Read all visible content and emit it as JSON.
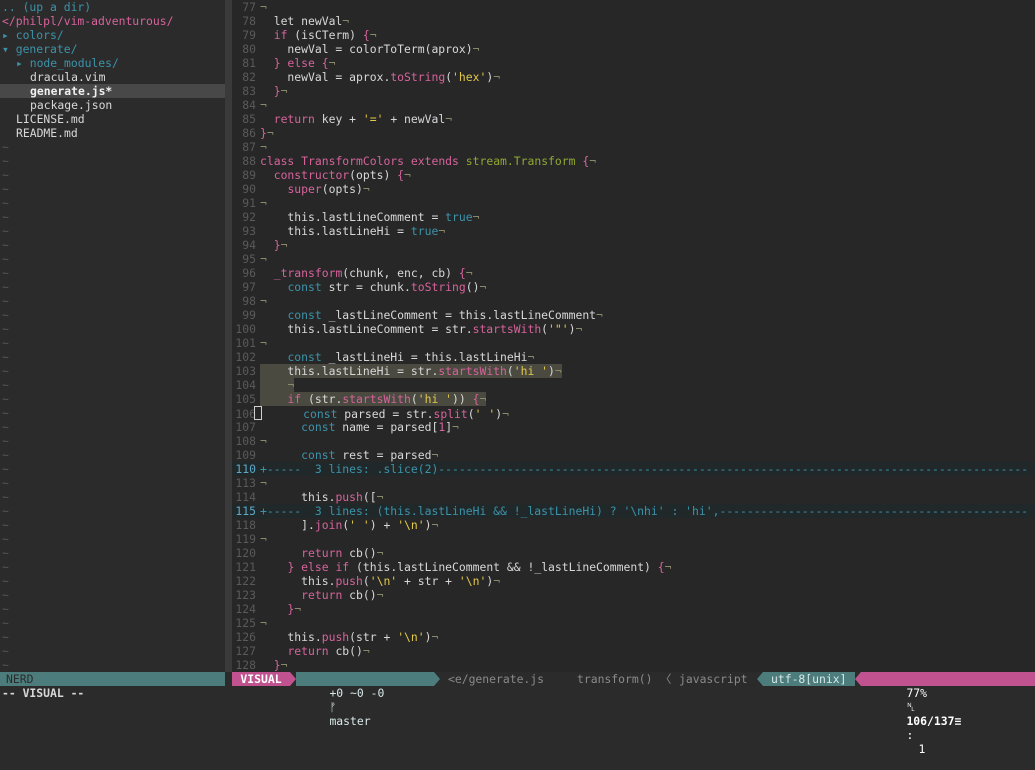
{
  "tree": {
    "up_dir": ".. (up a dir)",
    "root": "</philpl/vim-adventurous/",
    "items": [
      {
        "text": "▸ colors/",
        "kind": "dir",
        "indent": 0
      },
      {
        "text": "▾ generate/",
        "kind": "dir",
        "indent": 0
      },
      {
        "text": "▸ node_modules/",
        "kind": "dir",
        "indent": 1
      },
      {
        "text": "dracula.vim",
        "kind": "file",
        "indent": 2
      },
      {
        "text": "generate.js*",
        "kind": "exec",
        "indent": 2,
        "selected": true
      },
      {
        "text": "package.json",
        "kind": "file",
        "indent": 2
      },
      {
        "text": "LICENSE.md",
        "kind": "file",
        "indent": 1
      },
      {
        "text": "README.md",
        "kind": "file",
        "indent": 1
      }
    ],
    "tilde": "~",
    "tilde_count": 38
  },
  "editor": {
    "lines": [
      {
        "n": "77",
        "t": []
      },
      {
        "n": "78",
        "t": [
          [
            "  let newVal",
            "w"
          ]
        ]
      },
      {
        "n": "79",
        "t": [
          [
            "  ",
            "w"
          ],
          [
            "if",
            "p"
          ],
          [
            " (isCTerm) ",
            "w"
          ],
          [
            "{",
            "p"
          ]
        ]
      },
      {
        "n": "80",
        "t": [
          [
            "    newVal = colorToTerm(aprox)",
            "w"
          ]
        ]
      },
      {
        "n": "81",
        "t": [
          [
            "  ",
            "w"
          ],
          [
            "} else {",
            "p"
          ]
        ]
      },
      {
        "n": "82",
        "t": [
          [
            "    newVal = aprox.",
            "w"
          ],
          [
            "toString",
            "p"
          ],
          [
            "(",
            "w"
          ],
          [
            "'hex'",
            "y"
          ],
          [
            ")",
            "w"
          ]
        ]
      },
      {
        "n": "83",
        "t": [
          [
            "  }",
            "p"
          ]
        ]
      },
      {
        "n": "84",
        "t": []
      },
      {
        "n": "85",
        "t": [
          [
            "  ",
            "w"
          ],
          [
            "return",
            "p"
          ],
          [
            " key + ",
            "w"
          ],
          [
            "'='",
            "y"
          ],
          [
            " + newVal",
            "w"
          ]
        ]
      },
      {
        "n": "86",
        "t": [
          [
            "}",
            "p"
          ]
        ]
      },
      {
        "n": "87",
        "t": []
      },
      {
        "n": "88",
        "t": [
          [
            "class",
            "p"
          ],
          [
            " ",
            "w"
          ],
          [
            "TransformColors",
            "p"
          ],
          [
            " ",
            "w"
          ],
          [
            "extends",
            "p"
          ],
          [
            " ",
            "w"
          ],
          [
            "stream.Transform",
            "g"
          ],
          [
            " ",
            "w"
          ],
          [
            "{",
            "p"
          ]
        ]
      },
      {
        "n": "89",
        "t": [
          [
            "  ",
            "w"
          ],
          [
            "constructor",
            "p"
          ],
          [
            "(opts) ",
            "w"
          ],
          [
            "{",
            "p"
          ]
        ]
      },
      {
        "n": "90",
        "t": [
          [
            "    ",
            "w"
          ],
          [
            "super",
            "p"
          ],
          [
            "(opts)",
            "w"
          ]
        ]
      },
      {
        "n": "91",
        "t": []
      },
      {
        "n": "92",
        "t": [
          [
            "    this.lastLineComment = ",
            "w"
          ],
          [
            "true",
            "b"
          ]
        ]
      },
      {
        "n": "93",
        "t": [
          [
            "    this.lastLineHi = ",
            "w"
          ],
          [
            "true",
            "b"
          ]
        ]
      },
      {
        "n": "94",
        "t": [
          [
            "  }",
            "p"
          ]
        ]
      },
      {
        "n": "95",
        "t": []
      },
      {
        "n": "96",
        "t": [
          [
            "  ",
            "w"
          ],
          [
            "_transform",
            "p"
          ],
          [
            "(chunk, enc, cb) ",
            "w"
          ],
          [
            "{",
            "p"
          ]
        ]
      },
      {
        "n": "97",
        "t": [
          [
            "    ",
            "w"
          ],
          [
            "const",
            "b"
          ],
          [
            " str = chunk.",
            "w"
          ],
          [
            "toString",
            "p"
          ],
          [
            "()",
            "w"
          ]
        ]
      },
      {
        "n": "98",
        "t": []
      },
      {
        "n": "99",
        "t": [
          [
            "    ",
            "w"
          ],
          [
            "const",
            "b"
          ],
          [
            " _lastLineComment = this.lastLineComment",
            "w"
          ]
        ]
      },
      {
        "n": "100",
        "t": [
          [
            "    this.lastLineComment = str.",
            "w"
          ],
          [
            "startsWith",
            "p"
          ],
          [
            "(",
            "w"
          ],
          [
            "'\"'",
            "y"
          ],
          [
            ")",
            "w"
          ]
        ]
      },
      {
        "n": "101",
        "t": []
      },
      {
        "n": "102",
        "t": [
          [
            "    ",
            "w"
          ],
          [
            "const",
            "b"
          ],
          [
            " _lastLineHi = this.lastLineHi",
            "w"
          ]
        ]
      },
      {
        "n": "103",
        "vsel": true,
        "t": [
          [
            "    this.lastLineHi = str.",
            "w"
          ],
          [
            "startsWith",
            "p"
          ],
          [
            "(",
            "w"
          ],
          [
            "'hi '",
            "y"
          ],
          [
            ")",
            "w"
          ]
        ]
      },
      {
        "n": "104",
        "vsel": true,
        "t": [
          [
            "    ",
            "w"
          ]
        ]
      },
      {
        "n": "105",
        "vsel": true,
        "t": [
          [
            "    ",
            "w"
          ],
          [
            "if",
            "p"
          ],
          [
            " (str.",
            "w"
          ],
          [
            "startsWith",
            "p"
          ],
          [
            "(",
            "w"
          ],
          [
            "'hi '",
            "y"
          ],
          [
            ")) ",
            "w"
          ],
          [
            "{",
            "p"
          ]
        ]
      },
      {
        "n": "106",
        "cursor": true,
        "t": [
          [
            "      ",
            "w"
          ],
          [
            "const",
            "b"
          ],
          [
            " parsed = str.",
            "w"
          ],
          [
            "split",
            "p"
          ],
          [
            "(",
            "w"
          ],
          [
            "' '",
            "y"
          ],
          [
            ")",
            "w"
          ]
        ]
      },
      {
        "n": "107",
        "t": [
          [
            "      ",
            "w"
          ],
          [
            "const",
            "b"
          ],
          [
            " name = parsed[",
            "w"
          ],
          [
            "1",
            "p"
          ],
          [
            "]",
            "w"
          ]
        ]
      },
      {
        "n": "108",
        "t": []
      },
      {
        "n": "109",
        "t": [
          [
            "      ",
            "w"
          ],
          [
            "const",
            "b"
          ],
          [
            " rest = parsed",
            "w"
          ]
        ]
      },
      {
        "n": "110",
        "fold": true,
        "t": [
          [
            "+-----  3 lines: .slice(2)--------------------------------------------------------------------------------------",
            "f"
          ]
        ]
      },
      {
        "n": "113",
        "t": []
      },
      {
        "n": "114",
        "t": [
          [
            "      this.",
            "w"
          ],
          [
            "push",
            "p"
          ],
          [
            "([",
            "w"
          ]
        ]
      },
      {
        "n": "115",
        "fold": true,
        "t": [
          [
            "+-----  3 lines: (this.lastLineHi && !_lastLineHi) ? '\\nhi' : 'hi',---------------------------------------------",
            "f"
          ]
        ]
      },
      {
        "n": "118",
        "t": [
          [
            "      ].",
            "w"
          ],
          [
            "join",
            "p"
          ],
          [
            "(",
            "w"
          ],
          [
            "' '",
            "y"
          ],
          [
            ") + ",
            "w"
          ],
          [
            "'\\n'",
            "y"
          ],
          [
            ")",
            "w"
          ]
        ]
      },
      {
        "n": "119",
        "t": []
      },
      {
        "n": "120",
        "t": [
          [
            "      ",
            "w"
          ],
          [
            "return",
            "p"
          ],
          [
            " cb()",
            "w"
          ]
        ]
      },
      {
        "n": "121",
        "t": [
          [
            "    ",
            "w"
          ],
          [
            "} else if",
            "p"
          ],
          [
            " (this.lastLineComment && !_lastLineComment) ",
            "w"
          ],
          [
            "{",
            "p"
          ]
        ]
      },
      {
        "n": "122",
        "t": [
          [
            "      this.",
            "w"
          ],
          [
            "push",
            "p"
          ],
          [
            "(",
            "w"
          ],
          [
            "'\\n'",
            "y"
          ],
          [
            " + str + ",
            "w"
          ],
          [
            "'\\n'",
            "y"
          ],
          [
            ")",
            "w"
          ]
        ]
      },
      {
        "n": "123",
        "t": [
          [
            "      ",
            "w"
          ],
          [
            "return",
            "p"
          ],
          [
            " cb()",
            "w"
          ]
        ]
      },
      {
        "n": "124",
        "t": [
          [
            "    }",
            "p"
          ]
        ]
      },
      {
        "n": "125",
        "t": []
      },
      {
        "n": "126",
        "t": [
          [
            "    this.",
            "w"
          ],
          [
            "push",
            "p"
          ],
          [
            "(str + ",
            "w"
          ],
          [
            "'\\n'",
            "y"
          ],
          [
            ")",
            "w"
          ]
        ]
      },
      {
        "n": "127",
        "t": [
          [
            "    ",
            "w"
          ],
          [
            "return",
            "p"
          ],
          [
            " cb()",
            "w"
          ]
        ]
      },
      {
        "n": "128",
        "t": [
          [
            "  }",
            "p"
          ]
        ]
      }
    ]
  },
  "status": {
    "nerd": "NERD",
    "mode": "VISUAL",
    "git_changes": "+0 ~0 -0",
    "branch_icon": "ᚠ",
    "branch": "master",
    "file": "<e/generate.js",
    "func": "transform()",
    "sep_left": "〈",
    "filetype": "javascript",
    "encoding": "utf-8[unix]",
    "percent": "77%",
    "line_icon": "␤",
    "position": "106/137≡",
    "colon": ":",
    "col": "1"
  },
  "cmdline": "-- VISUAL --",
  "colors": {
    "white": "#d8d8d8",
    "pink": "#d6639c",
    "yellow": "#e3c94a",
    "green": "#8fa832",
    "blue": "#3c93aa",
    "nontext": "#8a8a6a",
    "mode_bg": "#c0538f",
    "teal_bg": "#4c7c7c"
  }
}
